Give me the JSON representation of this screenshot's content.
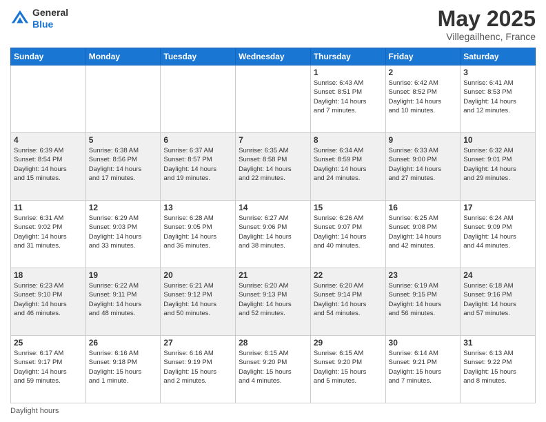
{
  "header": {
    "logo_general": "General",
    "logo_blue": "Blue",
    "title": "May 2025",
    "location": "Villegailhenc, France"
  },
  "footer": {
    "daylight_label": "Daylight hours"
  },
  "weekdays": [
    "Sunday",
    "Monday",
    "Tuesday",
    "Wednesday",
    "Thursday",
    "Friday",
    "Saturday"
  ],
  "weeks": [
    [
      {
        "day": "",
        "info": ""
      },
      {
        "day": "",
        "info": ""
      },
      {
        "day": "",
        "info": ""
      },
      {
        "day": "",
        "info": ""
      },
      {
        "day": "1",
        "info": "Sunrise: 6:43 AM\nSunset: 8:51 PM\nDaylight: 14 hours\nand 7 minutes."
      },
      {
        "day": "2",
        "info": "Sunrise: 6:42 AM\nSunset: 8:52 PM\nDaylight: 14 hours\nand 10 minutes."
      },
      {
        "day": "3",
        "info": "Sunrise: 6:41 AM\nSunset: 8:53 PM\nDaylight: 14 hours\nand 12 minutes."
      }
    ],
    [
      {
        "day": "4",
        "info": "Sunrise: 6:39 AM\nSunset: 8:54 PM\nDaylight: 14 hours\nand 15 minutes."
      },
      {
        "day": "5",
        "info": "Sunrise: 6:38 AM\nSunset: 8:56 PM\nDaylight: 14 hours\nand 17 minutes."
      },
      {
        "day": "6",
        "info": "Sunrise: 6:37 AM\nSunset: 8:57 PM\nDaylight: 14 hours\nand 19 minutes."
      },
      {
        "day": "7",
        "info": "Sunrise: 6:35 AM\nSunset: 8:58 PM\nDaylight: 14 hours\nand 22 minutes."
      },
      {
        "day": "8",
        "info": "Sunrise: 6:34 AM\nSunset: 8:59 PM\nDaylight: 14 hours\nand 24 minutes."
      },
      {
        "day": "9",
        "info": "Sunrise: 6:33 AM\nSunset: 9:00 PM\nDaylight: 14 hours\nand 27 minutes."
      },
      {
        "day": "10",
        "info": "Sunrise: 6:32 AM\nSunset: 9:01 PM\nDaylight: 14 hours\nand 29 minutes."
      }
    ],
    [
      {
        "day": "11",
        "info": "Sunrise: 6:31 AM\nSunset: 9:02 PM\nDaylight: 14 hours\nand 31 minutes."
      },
      {
        "day": "12",
        "info": "Sunrise: 6:29 AM\nSunset: 9:03 PM\nDaylight: 14 hours\nand 33 minutes."
      },
      {
        "day": "13",
        "info": "Sunrise: 6:28 AM\nSunset: 9:05 PM\nDaylight: 14 hours\nand 36 minutes."
      },
      {
        "day": "14",
        "info": "Sunrise: 6:27 AM\nSunset: 9:06 PM\nDaylight: 14 hours\nand 38 minutes."
      },
      {
        "day": "15",
        "info": "Sunrise: 6:26 AM\nSunset: 9:07 PM\nDaylight: 14 hours\nand 40 minutes."
      },
      {
        "day": "16",
        "info": "Sunrise: 6:25 AM\nSunset: 9:08 PM\nDaylight: 14 hours\nand 42 minutes."
      },
      {
        "day": "17",
        "info": "Sunrise: 6:24 AM\nSunset: 9:09 PM\nDaylight: 14 hours\nand 44 minutes."
      }
    ],
    [
      {
        "day": "18",
        "info": "Sunrise: 6:23 AM\nSunset: 9:10 PM\nDaylight: 14 hours\nand 46 minutes."
      },
      {
        "day": "19",
        "info": "Sunrise: 6:22 AM\nSunset: 9:11 PM\nDaylight: 14 hours\nand 48 minutes."
      },
      {
        "day": "20",
        "info": "Sunrise: 6:21 AM\nSunset: 9:12 PM\nDaylight: 14 hours\nand 50 minutes."
      },
      {
        "day": "21",
        "info": "Sunrise: 6:20 AM\nSunset: 9:13 PM\nDaylight: 14 hours\nand 52 minutes."
      },
      {
        "day": "22",
        "info": "Sunrise: 6:20 AM\nSunset: 9:14 PM\nDaylight: 14 hours\nand 54 minutes."
      },
      {
        "day": "23",
        "info": "Sunrise: 6:19 AM\nSunset: 9:15 PM\nDaylight: 14 hours\nand 56 minutes."
      },
      {
        "day": "24",
        "info": "Sunrise: 6:18 AM\nSunset: 9:16 PM\nDaylight: 14 hours\nand 57 minutes."
      }
    ],
    [
      {
        "day": "25",
        "info": "Sunrise: 6:17 AM\nSunset: 9:17 PM\nDaylight: 14 hours\nand 59 minutes."
      },
      {
        "day": "26",
        "info": "Sunrise: 6:16 AM\nSunset: 9:18 PM\nDaylight: 15 hours\nand 1 minute."
      },
      {
        "day": "27",
        "info": "Sunrise: 6:16 AM\nSunset: 9:19 PM\nDaylight: 15 hours\nand 2 minutes."
      },
      {
        "day": "28",
        "info": "Sunrise: 6:15 AM\nSunset: 9:20 PM\nDaylight: 15 hours\nand 4 minutes."
      },
      {
        "day": "29",
        "info": "Sunrise: 6:15 AM\nSunset: 9:20 PM\nDaylight: 15 hours\nand 5 minutes."
      },
      {
        "day": "30",
        "info": "Sunrise: 6:14 AM\nSunset: 9:21 PM\nDaylight: 15 hours\nand 7 minutes."
      },
      {
        "day": "31",
        "info": "Sunrise: 6:13 AM\nSunset: 9:22 PM\nDaylight: 15 hours\nand 8 minutes."
      }
    ]
  ]
}
